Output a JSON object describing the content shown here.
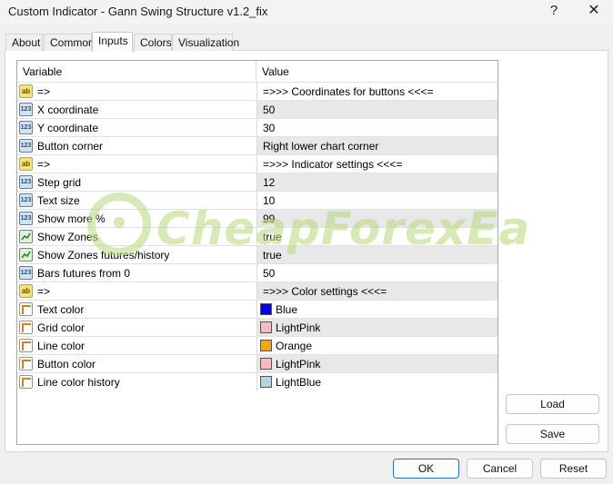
{
  "window": {
    "title": "Custom Indicator - Gann Swing Structure v1.2_fix",
    "help_label": "?",
    "close_label": "✕"
  },
  "tabs": [
    {
      "label": "About"
    },
    {
      "label": "Common"
    },
    {
      "label": "Inputs",
      "active": true
    },
    {
      "label": "Colors"
    },
    {
      "label": "Visualization"
    }
  ],
  "grid": {
    "header_variable": "Variable",
    "header_value": "Value",
    "rows": [
      {
        "icon": "ab",
        "variable": "=>",
        "value": "=>>> Coordinates for buttons <<<="
      },
      {
        "icon": "num",
        "variable": "X coordinate",
        "value": "50"
      },
      {
        "icon": "num",
        "variable": "Y coordinate",
        "value": "30"
      },
      {
        "icon": "num",
        "variable": "Button corner",
        "value": "Right lower chart corner"
      },
      {
        "icon": "ab",
        "variable": "=>",
        "value": "=>>> Indicator settings <<<="
      },
      {
        "icon": "num",
        "variable": "Step grid",
        "value": "12"
      },
      {
        "icon": "num",
        "variable": "Text size",
        "value": "10"
      },
      {
        "icon": "num",
        "variable": "Show more %",
        "value": "99"
      },
      {
        "icon": "chk",
        "variable": "Show Zones",
        "value": "true"
      },
      {
        "icon": "chk",
        "variable": "Show Zones futures/history",
        "value": "true"
      },
      {
        "icon": "num",
        "variable": "Bars futures from 0",
        "value": "50"
      },
      {
        "icon": "ab",
        "variable": "=>",
        "value": "=>>> Color settings <<<="
      },
      {
        "icon": "col",
        "variable": "Text color",
        "value": "Blue",
        "swatch": "#0000ff"
      },
      {
        "icon": "col",
        "variable": "Grid color",
        "value": "LightPink",
        "swatch": "#ffb6c1"
      },
      {
        "icon": "col",
        "variable": "Line color",
        "value": "Orange",
        "swatch": "#ffa500"
      },
      {
        "icon": "col",
        "variable": "Button color",
        "value": "LightPink",
        "swatch": "#ffb6c1"
      },
      {
        "icon": "col",
        "variable": "Line color history",
        "value": "LightBlue",
        "swatch": "#add8e6"
      }
    ]
  },
  "icons": {
    "ab": "ab",
    "num": "123"
  },
  "watermark": {
    "text": "CheapForexEa"
  },
  "buttons": {
    "load": "Load",
    "save": "Save",
    "ok": "OK",
    "cancel": "Cancel",
    "reset": "Reset"
  },
  "colors": {
    "accent": "#2f6fc2",
    "watermark": "#b8d87a"
  }
}
